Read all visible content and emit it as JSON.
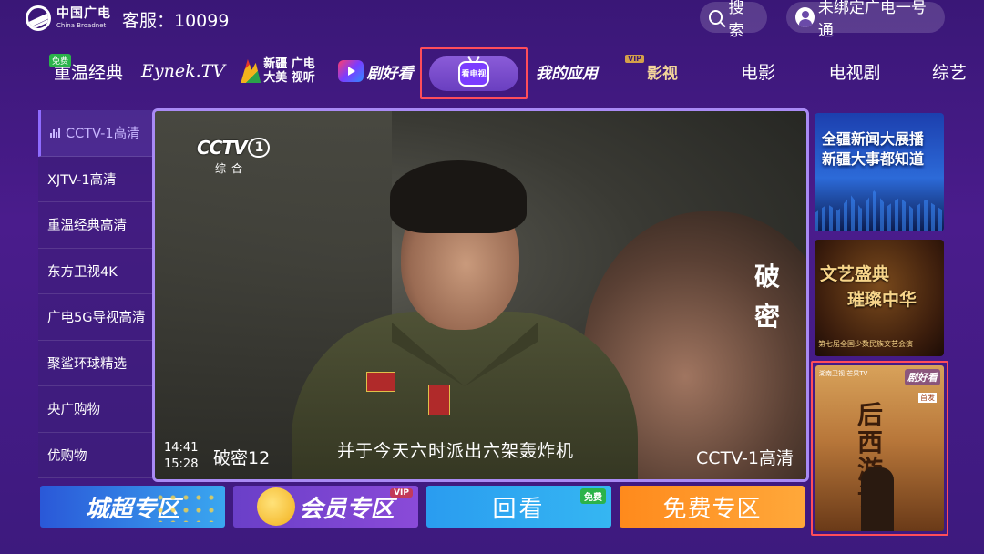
{
  "header": {
    "logo_cn": "中国广电",
    "logo_en": "China Broadnet",
    "hotline": "客服：10099",
    "search_label": "搜索",
    "account_label": "未绑定广电一号通"
  },
  "nav": {
    "classic_free": "免费",
    "classic": "重温经典",
    "eynek": "Eynek.TV",
    "xinjiang_line1": "新疆 广电",
    "xinjiang_line2": "大美 视听",
    "juhao": "剧好看",
    "tv_icon_text": "看电视",
    "apps": "我的应用",
    "vip_tag": "VIP",
    "vip": "影视",
    "movie": "电影",
    "drama": "电视剧",
    "variety": "综艺"
  },
  "channels": [
    {
      "name": "CCTV-1高清",
      "active": true
    },
    {
      "name": "XJTV-1高清"
    },
    {
      "name": "重温经典高清"
    },
    {
      "name": "东方卫视4K"
    },
    {
      "name": "广电5G导视高清"
    },
    {
      "name": "聚鲨环球精选"
    },
    {
      "name": "央广购物"
    },
    {
      "name": "优购物"
    }
  ],
  "player": {
    "logo": "CCTV",
    "logo_num": "1",
    "logo_sub": "综合",
    "drama_title": "破密",
    "time_now": "14:41",
    "time_end": "15:28",
    "episode": "破密12",
    "subtitle": "并于今天六时派出六架轰炸机",
    "channel": "CCTV-1高清"
  },
  "posters": {
    "news_line1": "全疆新闻大展播",
    "news_line2": "新疆大事都知道",
    "gala_line1": "文艺盛典",
    "gala_line2": "璀璨中华",
    "gala_sub": "第七届全国少数民族文艺会演",
    "drama_brand": "剧好看",
    "drama_top": "湖南卫视 芒果TV",
    "drama_badge": "首发",
    "drama_title": "后西游记"
  },
  "tiles": {
    "city": "城超专区",
    "vip": "会员专区",
    "vip_tag": "VIP",
    "replay": "回看",
    "replay_tag": "免费",
    "free": "免费专区"
  }
}
